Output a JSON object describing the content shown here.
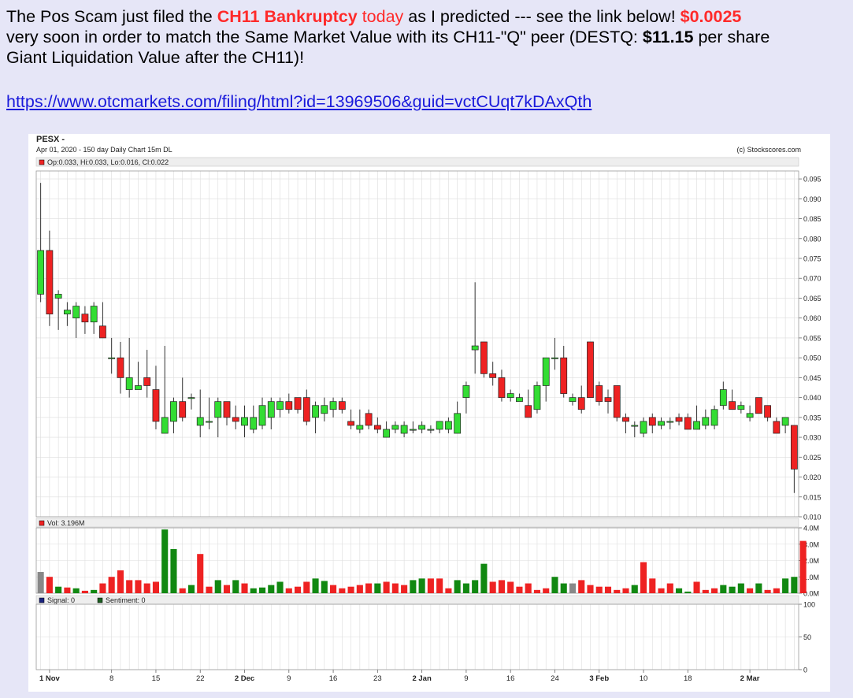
{
  "post": {
    "line1_a": "The Pos Scam just filed the ",
    "line1_b": "CH11 Bankruptcy",
    "line1_c": " today",
    "line1_d": " as I predicted --- see the link below! ",
    "line1_e": "$0.0025",
    "line2_a": "very soon in order to match the Same Market Value with its CH11-\"Q\" peer (DESTQ: ",
    "line2_b": "$11.15",
    "line2_c": " per share",
    "line3": "Giant Liquidation Value after the CH11)!",
    "link": "https://www.otcmarkets.com/filing/html?id=13969506&guid=vctCUqt7kDAxQth"
  },
  "chart_header": {
    "ticker": "PESX -",
    "subtitle": "Apr 01, 2020 - 150 day  Daily Chart 15m DL",
    "copyright": "(c) Stockscores.com",
    "ohlc_label": "Op:0.033, Hi:0.033, Lo:0.016, Cl:0.022",
    "vol_label": "Vol: 3.196M",
    "signal_label": "Signal: 0",
    "sentiment_label": "Sentiment: 0"
  },
  "colors": {
    "up": "#33dd33",
    "down": "#ee2222",
    "vol_up": "#118811",
    "vol_down": "#ee2222",
    "vol_neutral": "#888888",
    "grid": "#dddddd",
    "signal": "#1a237e",
    "sentiment": "#1b5e20"
  },
  "chart_data": {
    "type": "candlestick",
    "x_labels": [
      "1 Nov",
      "8",
      "15",
      "22",
      "2 Dec",
      "9",
      "16",
      "23",
      "2 Jan",
      "9",
      "16",
      "24",
      "3 Feb",
      "10",
      "18",
      "2 Mar"
    ],
    "x_label_bold": [
      true,
      false,
      false,
      false,
      true,
      false,
      false,
      false,
      true,
      false,
      false,
      false,
      true,
      false,
      false,
      true
    ],
    "x_label_index": [
      1,
      8,
      13,
      18,
      23,
      28,
      33,
      38,
      43,
      48,
      53,
      58,
      63,
      68,
      73,
      80
    ],
    "price_axis": {
      "ticks": [
        "0.095",
        "0.090",
        "0.085",
        "0.080",
        "0.075",
        "0.070",
        "0.065",
        "0.060",
        "0.055",
        "0.050",
        "0.045",
        "0.040",
        "0.035",
        "0.030",
        "0.025",
        "0.020",
        "0.015",
        "0.010"
      ],
      "ylim": [
        0.01,
        0.097
      ]
    },
    "volume_axis": {
      "ticks": [
        "4.0M",
        "3.0M",
        "2.0M",
        "1.0M",
        "0.0M"
      ],
      "ylim": [
        0,
        4.0
      ]
    },
    "indicator_axis": {
      "ticks": [
        "100",
        "50",
        "0"
      ],
      "ylim": [
        0,
        100
      ]
    },
    "candles": [
      {
        "o": 0.066,
        "h": 0.094,
        "l": 0.064,
        "c": 0.077
      },
      {
        "o": 0.077,
        "h": 0.082,
        "l": 0.058,
        "c": 0.061
      },
      {
        "o": 0.065,
        "h": 0.067,
        "l": 0.057,
        "c": 0.066
      },
      {
        "o": 0.061,
        "h": 0.064,
        "l": 0.058,
        "c": 0.062
      },
      {
        "o": 0.06,
        "h": 0.064,
        "l": 0.055,
        "c": 0.063
      },
      {
        "o": 0.061,
        "h": 0.063,
        "l": 0.056,
        "c": 0.059
      },
      {
        "o": 0.059,
        "h": 0.064,
        "l": 0.056,
        "c": 0.063
      },
      {
        "o": 0.058,
        "h": 0.064,
        "l": 0.055,
        "c": 0.055
      },
      {
        "o": 0.05,
        "h": 0.055,
        "l": 0.046,
        "c": 0.05
      },
      {
        "o": 0.05,
        "h": 0.054,
        "l": 0.041,
        "c": 0.045
      },
      {
        "o": 0.042,
        "h": 0.055,
        "l": 0.04,
        "c": 0.045
      },
      {
        "o": 0.042,
        "h": 0.049,
        "l": 0.042,
        "c": 0.043
      },
      {
        "o": 0.045,
        "h": 0.052,
        "l": 0.04,
        "c": 0.043
      },
      {
        "o": 0.042,
        "h": 0.048,
        "l": 0.032,
        "c": 0.034
      },
      {
        "o": 0.031,
        "h": 0.053,
        "l": 0.031,
        "c": 0.035
      },
      {
        "o": 0.034,
        "h": 0.04,
        "l": 0.031,
        "c": 0.039
      },
      {
        "o": 0.039,
        "h": 0.045,
        "l": 0.034,
        "c": 0.035
      },
      {
        "o": 0.04,
        "h": 0.041,
        "l": 0.037,
        "c": 0.04
      },
      {
        "o": 0.033,
        "h": 0.042,
        "l": 0.03,
        "c": 0.035
      },
      {
        "o": 0.034,
        "h": 0.04,
        "l": 0.032,
        "c": 0.034
      },
      {
        "o": 0.035,
        "h": 0.04,
        "l": 0.03,
        "c": 0.039
      },
      {
        "o": 0.039,
        "h": 0.039,
        "l": 0.033,
        "c": 0.035
      },
      {
        "o": 0.035,
        "h": 0.038,
        "l": 0.032,
        "c": 0.034
      },
      {
        "o": 0.033,
        "h": 0.038,
        "l": 0.03,
        "c": 0.035
      },
      {
        "o": 0.032,
        "h": 0.038,
        "l": 0.031,
        "c": 0.035
      },
      {
        "o": 0.033,
        "h": 0.04,
        "l": 0.032,
        "c": 0.038
      },
      {
        "o": 0.035,
        "h": 0.04,
        "l": 0.032,
        "c": 0.039
      },
      {
        "o": 0.037,
        "h": 0.04,
        "l": 0.035,
        "c": 0.039
      },
      {
        "o": 0.039,
        "h": 0.041,
        "l": 0.036,
        "c": 0.037
      },
      {
        "o": 0.04,
        "h": 0.04,
        "l": 0.036,
        "c": 0.037
      },
      {
        "o": 0.04,
        "h": 0.042,
        "l": 0.033,
        "c": 0.034
      },
      {
        "o": 0.035,
        "h": 0.039,
        "l": 0.031,
        "c": 0.038
      },
      {
        "o": 0.036,
        "h": 0.04,
        "l": 0.034,
        "c": 0.038
      },
      {
        "o": 0.037,
        "h": 0.04,
        "l": 0.035,
        "c": 0.039
      },
      {
        "o": 0.039,
        "h": 0.04,
        "l": 0.036,
        "c": 0.037
      },
      {
        "o": 0.034,
        "h": 0.037,
        "l": 0.032,
        "c": 0.033
      },
      {
        "o": 0.032,
        "h": 0.037,
        "l": 0.031,
        "c": 0.033
      },
      {
        "o": 0.036,
        "h": 0.037,
        "l": 0.032,
        "c": 0.033
      },
      {
        "o": 0.033,
        "h": 0.035,
        "l": 0.031,
        "c": 0.032
      },
      {
        "o": 0.03,
        "h": 0.034,
        "l": 0.03,
        "c": 0.032
      },
      {
        "o": 0.032,
        "h": 0.034,
        "l": 0.031,
        "c": 0.033
      },
      {
        "o": 0.031,
        "h": 0.034,
        "l": 0.03,
        "c": 0.033
      },
      {
        "o": 0.032,
        "h": 0.034,
        "l": 0.031,
        "c": 0.032
      },
      {
        "o": 0.032,
        "h": 0.034,
        "l": 0.031,
        "c": 0.033
      },
      {
        "o": 0.032,
        "h": 0.033,
        "l": 0.031,
        "c": 0.032
      },
      {
        "o": 0.032,
        "h": 0.034,
        "l": 0.031,
        "c": 0.034
      },
      {
        "o": 0.032,
        "h": 0.035,
        "l": 0.031,
        "c": 0.034
      },
      {
        "o": 0.031,
        "h": 0.039,
        "l": 0.031,
        "c": 0.036
      },
      {
        "o": 0.04,
        "h": 0.044,
        "l": 0.036,
        "c": 0.043
      },
      {
        "o": 0.052,
        "h": 0.069,
        "l": 0.046,
        "c": 0.053
      },
      {
        "o": 0.054,
        "h": 0.054,
        "l": 0.045,
        "c": 0.046
      },
      {
        "o": 0.046,
        "h": 0.049,
        "l": 0.043,
        "c": 0.045
      },
      {
        "o": 0.045,
        "h": 0.047,
        "l": 0.039,
        "c": 0.04
      },
      {
        "o": 0.04,
        "h": 0.042,
        "l": 0.039,
        "c": 0.041
      },
      {
        "o": 0.039,
        "h": 0.041,
        "l": 0.039,
        "c": 0.04
      },
      {
        "o": 0.038,
        "h": 0.042,
        "l": 0.035,
        "c": 0.035
      },
      {
        "o": 0.037,
        "h": 0.044,
        "l": 0.036,
        "c": 0.043
      },
      {
        "o": 0.043,
        "h": 0.05,
        "l": 0.039,
        "c": 0.05
      },
      {
        "o": 0.05,
        "h": 0.055,
        "l": 0.047,
        "c": 0.05
      },
      {
        "o": 0.05,
        "h": 0.053,
        "l": 0.04,
        "c": 0.041
      },
      {
        "o": 0.039,
        "h": 0.041,
        "l": 0.038,
        "c": 0.04
      },
      {
        "o": 0.04,
        "h": 0.043,
        "l": 0.036,
        "c": 0.037
      },
      {
        "o": 0.054,
        "h": 0.054,
        "l": 0.04,
        "c": 0.04
      },
      {
        "o": 0.043,
        "h": 0.044,
        "l": 0.038,
        "c": 0.039
      },
      {
        "o": 0.04,
        "h": 0.042,
        "l": 0.036,
        "c": 0.039
      },
      {
        "o": 0.043,
        "h": 0.043,
        "l": 0.034,
        "c": 0.035
      },
      {
        "o": 0.035,
        "h": 0.036,
        "l": 0.031,
        "c": 0.034
      },
      {
        "o": 0.033,
        "h": 0.034,
        "l": 0.03,
        "c": 0.033
      },
      {
        "o": 0.031,
        "h": 0.035,
        "l": 0.03,
        "c": 0.034
      },
      {
        "o": 0.035,
        "h": 0.036,
        "l": 0.031,
        "c": 0.033
      },
      {
        "o": 0.033,
        "h": 0.035,
        "l": 0.032,
        "c": 0.034
      },
      {
        "o": 0.034,
        "h": 0.035,
        "l": 0.032,
        "c": 0.034
      },
      {
        "o": 0.035,
        "h": 0.036,
        "l": 0.033,
        "c": 0.034
      },
      {
        "o": 0.035,
        "h": 0.036,
        "l": 0.032,
        "c": 0.032
      },
      {
        "o": 0.032,
        "h": 0.038,
        "l": 0.032,
        "c": 0.034
      },
      {
        "o": 0.033,
        "h": 0.037,
        "l": 0.032,
        "c": 0.035
      },
      {
        "o": 0.033,
        "h": 0.038,
        "l": 0.032,
        "c": 0.037
      },
      {
        "o": 0.038,
        "h": 0.044,
        "l": 0.037,
        "c": 0.042
      },
      {
        "o": 0.039,
        "h": 0.042,
        "l": 0.037,
        "c": 0.037
      },
      {
        "o": 0.037,
        "h": 0.039,
        "l": 0.036,
        "c": 0.038
      },
      {
        "o": 0.035,
        "h": 0.038,
        "l": 0.034,
        "c": 0.036
      },
      {
        "o": 0.04,
        "h": 0.04,
        "l": 0.036,
        "c": 0.036
      },
      {
        "o": 0.038,
        "h": 0.038,
        "l": 0.034,
        "c": 0.035
      },
      {
        "o": 0.034,
        "h": 0.035,
        "l": 0.031,
        "c": 0.031
      },
      {
        "o": 0.033,
        "h": 0.034,
        "l": 0.031,
        "c": 0.035
      },
      {
        "o": 0.033,
        "h": 0.033,
        "l": 0.016,
        "c": 0.022
      }
    ],
    "volume": [
      {
        "v": 1.3,
        "d": "n"
      },
      {
        "v": 1.0,
        "d": "d"
      },
      {
        "v": 0.4,
        "d": "u"
      },
      {
        "v": 0.35,
        "d": "d"
      },
      {
        "v": 0.3,
        "d": "u"
      },
      {
        "v": 0.15,
        "d": "d"
      },
      {
        "v": 0.2,
        "d": "u"
      },
      {
        "v": 0.6,
        "d": "d"
      },
      {
        "v": 1.0,
        "d": "d"
      },
      {
        "v": 1.4,
        "d": "d"
      },
      {
        "v": 0.8,
        "d": "d"
      },
      {
        "v": 0.8,
        "d": "d"
      },
      {
        "v": 0.6,
        "d": "d"
      },
      {
        "v": 0.7,
        "d": "d"
      },
      {
        "v": 3.9,
        "d": "u"
      },
      {
        "v": 2.7,
        "d": "u"
      },
      {
        "v": 0.3,
        "d": "d"
      },
      {
        "v": 0.5,
        "d": "u"
      },
      {
        "v": 2.4,
        "d": "d"
      },
      {
        "v": 0.4,
        "d": "d"
      },
      {
        "v": 0.8,
        "d": "u"
      },
      {
        "v": 0.5,
        "d": "d"
      },
      {
        "v": 0.8,
        "d": "u"
      },
      {
        "v": 0.6,
        "d": "d"
      },
      {
        "v": 0.3,
        "d": "u"
      },
      {
        "v": 0.35,
        "d": "u"
      },
      {
        "v": 0.5,
        "d": "u"
      },
      {
        "v": 0.7,
        "d": "u"
      },
      {
        "v": 0.3,
        "d": "d"
      },
      {
        "v": 0.4,
        "d": "d"
      },
      {
        "v": 0.7,
        "d": "d"
      },
      {
        "v": 0.9,
        "d": "u"
      },
      {
        "v": 0.75,
        "d": "u"
      },
      {
        "v": 0.5,
        "d": "d"
      },
      {
        "v": 0.3,
        "d": "d"
      },
      {
        "v": 0.4,
        "d": "d"
      },
      {
        "v": 0.5,
        "d": "d"
      },
      {
        "v": 0.6,
        "d": "d"
      },
      {
        "v": 0.6,
        "d": "u"
      },
      {
        "v": 0.7,
        "d": "d"
      },
      {
        "v": 0.6,
        "d": "d"
      },
      {
        "v": 0.5,
        "d": "d"
      },
      {
        "v": 0.8,
        "d": "u"
      },
      {
        "v": 0.9,
        "d": "u"
      },
      {
        "v": 0.9,
        "d": "d"
      },
      {
        "v": 0.9,
        "d": "d"
      },
      {
        "v": 0.3,
        "d": "d"
      },
      {
        "v": 0.8,
        "d": "u"
      },
      {
        "v": 0.6,
        "d": "u"
      },
      {
        "v": 0.8,
        "d": "u"
      },
      {
        "v": 1.8,
        "d": "u"
      },
      {
        "v": 0.7,
        "d": "d"
      },
      {
        "v": 0.8,
        "d": "d"
      },
      {
        "v": 0.7,
        "d": "d"
      },
      {
        "v": 0.4,
        "d": "d"
      },
      {
        "v": 0.6,
        "d": "d"
      },
      {
        "v": 0.2,
        "d": "d"
      },
      {
        "v": 0.3,
        "d": "d"
      },
      {
        "v": 1.0,
        "d": "u"
      },
      {
        "v": 0.6,
        "d": "u"
      },
      {
        "v": 0.6,
        "d": "n"
      },
      {
        "v": 0.8,
        "d": "d"
      },
      {
        "v": 0.5,
        "d": "d"
      },
      {
        "v": 0.4,
        "d": "d"
      },
      {
        "v": 0.4,
        "d": "d"
      },
      {
        "v": 0.2,
        "d": "d"
      },
      {
        "v": 0.3,
        "d": "d"
      },
      {
        "v": 0.5,
        "d": "u"
      },
      {
        "v": 1.9,
        "d": "d"
      },
      {
        "v": 0.9,
        "d": "d"
      },
      {
        "v": 0.3,
        "d": "d"
      },
      {
        "v": 0.6,
        "d": "d"
      },
      {
        "v": 0.3,
        "d": "u"
      },
      {
        "v": 0.1,
        "d": "u"
      },
      {
        "v": 0.7,
        "d": "d"
      },
      {
        "v": 0.2,
        "d": "d"
      },
      {
        "v": 0.3,
        "d": "d"
      },
      {
        "v": 0.5,
        "d": "u"
      },
      {
        "v": 0.4,
        "d": "u"
      },
      {
        "v": 0.6,
        "d": "u"
      },
      {
        "v": 0.3,
        "d": "d"
      },
      {
        "v": 0.6,
        "d": "u"
      },
      {
        "v": 0.2,
        "d": "d"
      },
      {
        "v": 0.3,
        "d": "d"
      },
      {
        "v": 0.9,
        "d": "u"
      },
      {
        "v": 1.0,
        "d": "u"
      },
      {
        "v": 3.2,
        "d": "d"
      }
    ]
  }
}
